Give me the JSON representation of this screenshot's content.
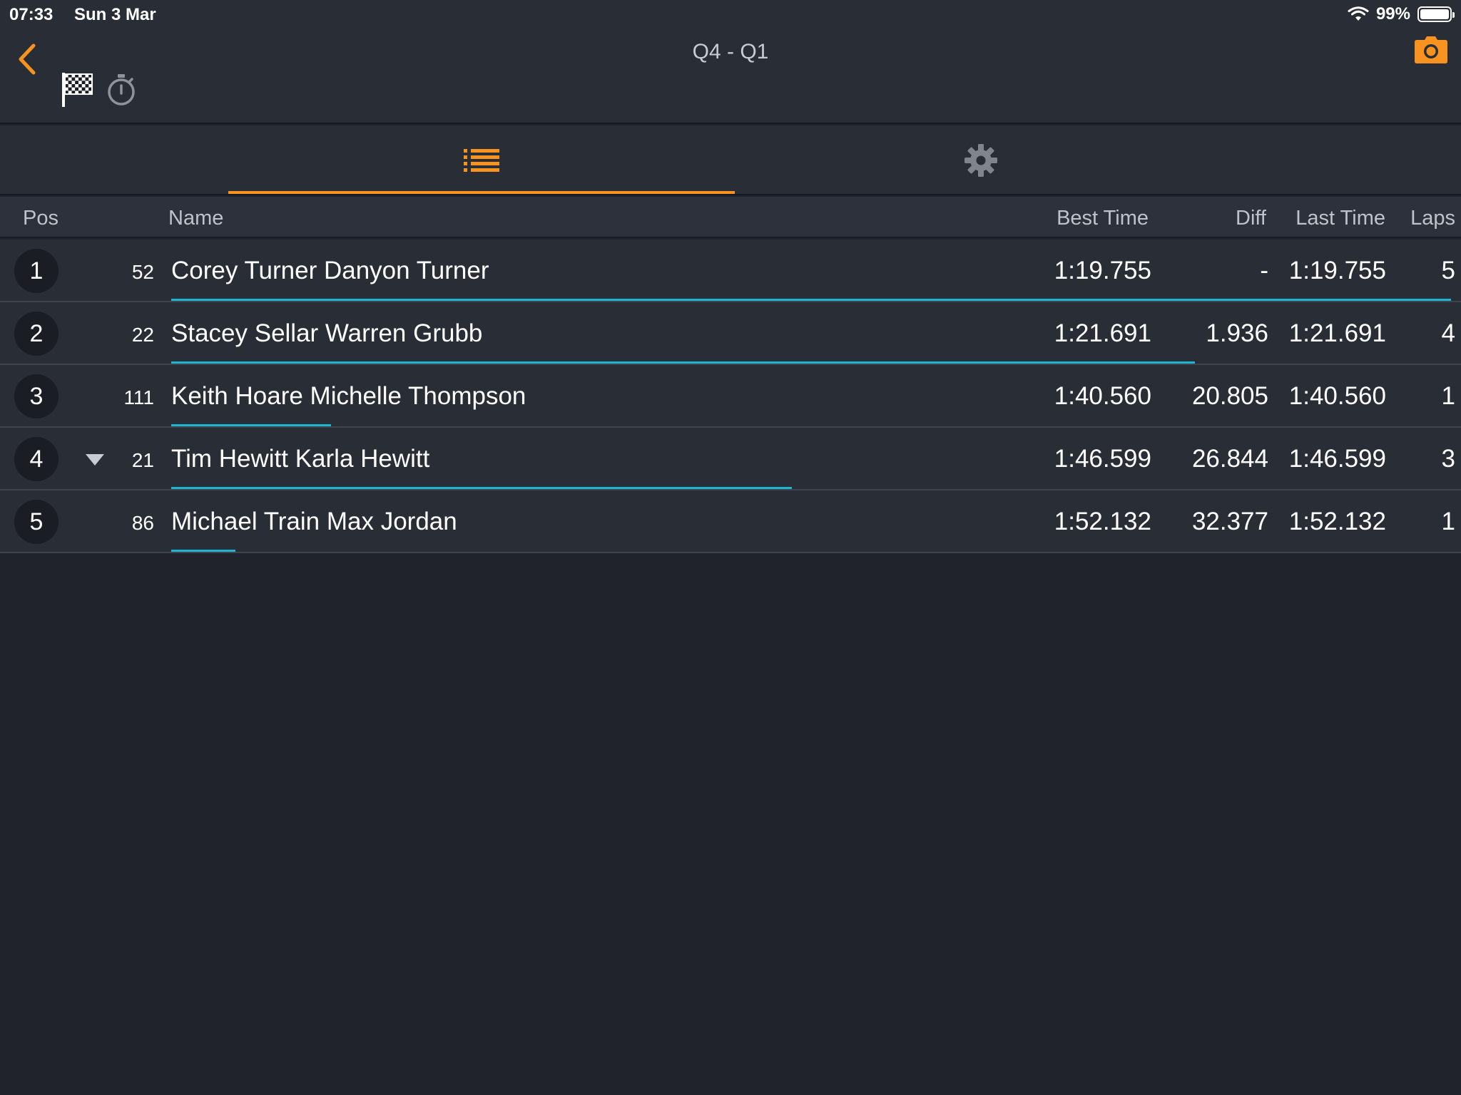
{
  "status_bar": {
    "time": "07:33",
    "date": "Sun 3 Mar",
    "battery": "99%",
    "battery_level": 0.99
  },
  "header": {
    "title": "Q4 - Q1",
    "back_icon": "chevron-left-icon",
    "flag_icon": "checkered-flag-icon",
    "stopwatch_icon": "stopwatch-icon",
    "camera_icon": "camera-icon"
  },
  "tabs": [
    {
      "icon": "list-icon",
      "selected": true
    },
    {
      "icon": "gear-icon",
      "selected": false
    }
  ],
  "columns": {
    "pos": "Pos",
    "name": "Name",
    "best_time": "Best Time",
    "diff": "Diff",
    "last_time": "Last Time",
    "laps": "Laps"
  },
  "rows": [
    {
      "pos": "1",
      "number": "52",
      "name": "Corey Turner Danyon Turner",
      "best_time": "1:19.755",
      "diff": "-",
      "last_time": "1:19.755",
      "laps": "5",
      "trend": "none",
      "progress": 1.0
    },
    {
      "pos": "2",
      "number": "22",
      "name": "Stacey Sellar Warren Grubb",
      "best_time": "1:21.691",
      "diff": "1.936",
      "last_time": "1:21.691",
      "laps": "4",
      "trend": "none",
      "progress": 0.8
    },
    {
      "pos": "3",
      "number": "111",
      "name": "Keith Hoare Michelle Thompson",
      "best_time": "1:40.560",
      "diff": "20.805",
      "last_time": "1:40.560",
      "laps": "1",
      "trend": "none",
      "progress": 0.125
    },
    {
      "pos": "4",
      "number": "21",
      "name": "Tim Hewitt Karla Hewitt",
      "best_time": "1:46.599",
      "diff": "26.844",
      "last_time": "1:46.599",
      "laps": "3",
      "trend": "down",
      "progress": 0.485
    },
    {
      "pos": "5",
      "number": "86",
      "name": "Michael Train Max Jordan",
      "best_time": "1:52.132",
      "diff": "32.377",
      "last_time": "1:52.132",
      "laps": "1",
      "trend": "none",
      "progress": 0.05
    }
  ],
  "colors": {
    "accent": "#f7931e",
    "progress": "#1fb4d2",
    "background": "#20232b",
    "row_background": "#292d36"
  }
}
